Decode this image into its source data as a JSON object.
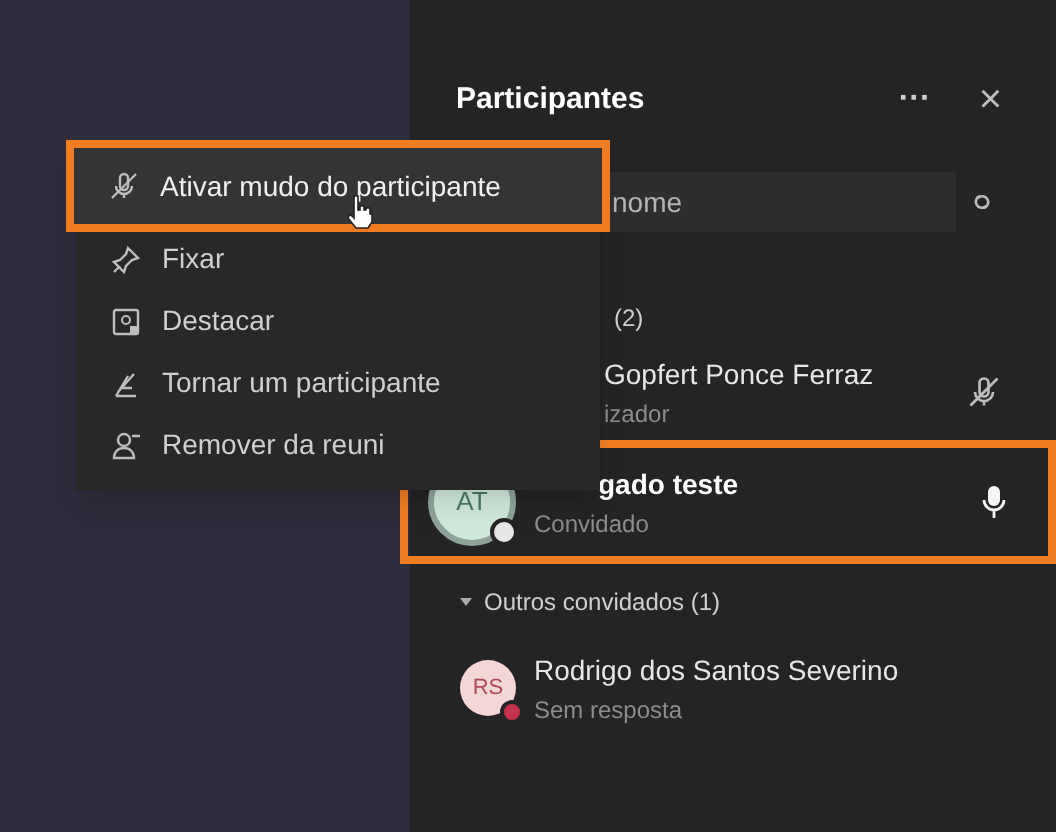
{
  "menu": {
    "items": [
      {
        "label": "Ativar mudo do participante",
        "hovered": true,
        "annotated": true
      },
      {
        "label": "Fixar",
        "hovered": false,
        "annotated": false
      },
      {
        "label": "Destacar",
        "hovered": false,
        "annotated": false
      },
      {
        "label": "Tornar um participante",
        "hovered": false,
        "annotated": false
      },
      {
        "label": "Remover da reuni",
        "hovered": false,
        "annotated": false
      }
    ]
  },
  "panel": {
    "title": "Participantes",
    "more": "···",
    "close": "×",
    "search": {
      "placeholder": "nome"
    },
    "sections": [
      {
        "label": "(2)",
        "participants": [
          {
            "name": "Gopfert Ponce Ferraz",
            "role": "izador",
            "muted": true,
            "annotated": false
          },
          {
            "name": "gado teste",
            "name_obscured": true,
            "role": "Convidado",
            "initials": "AT",
            "color": "#e6e6e6",
            "muted": false,
            "annotated": true
          }
        ]
      },
      {
        "label": "Outros convidados (1)",
        "expanded": true,
        "participants": [
          {
            "name": "Rodrigo dos Santos Severino",
            "role": "Sem resposta",
            "initials": "RS",
            "color": "#c4314b",
            "annotated": false
          }
        ]
      }
    ]
  }
}
